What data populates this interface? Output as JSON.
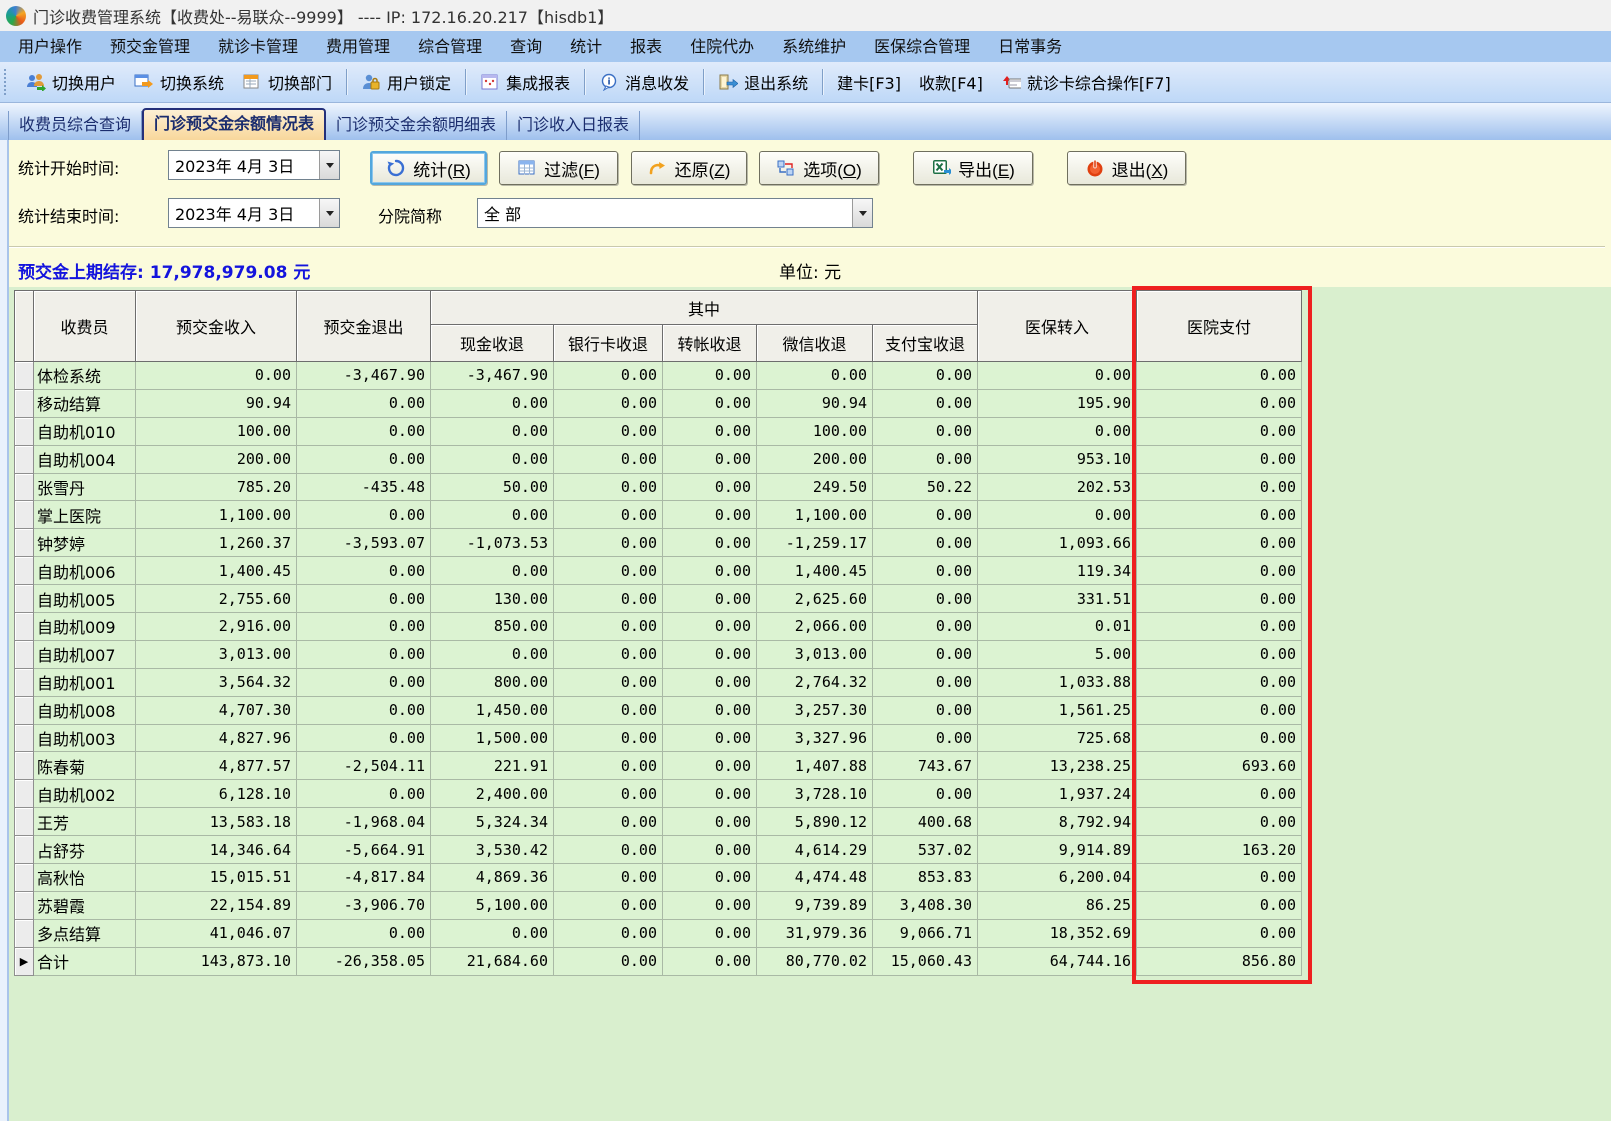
{
  "window": {
    "title": "门诊收费管理系统【收费处--易联众--9999】 ---- IP: 172.16.20.217【hisdb1】"
  },
  "menu": {
    "items": [
      "用户操作",
      "预交金管理",
      "就诊卡管理",
      "费用管理",
      "综合管理",
      "查询",
      "统计",
      "报表",
      "住院代办",
      "系统维护",
      "医保综合管理",
      "日常事务"
    ]
  },
  "toolbar": {
    "items": [
      {
        "type": "button",
        "label": "切换用户",
        "icon": "switch-user-icon"
      },
      {
        "type": "button",
        "label": "切换系统",
        "icon": "switch-system-icon"
      },
      {
        "type": "button",
        "label": "切换部门",
        "icon": "switch-department-icon"
      },
      {
        "type": "sep"
      },
      {
        "type": "button",
        "label": "用户锁定",
        "icon": "user-lock-icon"
      },
      {
        "type": "sep"
      },
      {
        "type": "button",
        "label": "集成报表",
        "icon": "integrated-report-icon"
      },
      {
        "type": "sep"
      },
      {
        "type": "button",
        "label": "消息收发",
        "icon": "message-icon"
      },
      {
        "type": "sep"
      },
      {
        "type": "button",
        "label": "退出系统",
        "icon": "exit-system-icon"
      },
      {
        "type": "sep"
      },
      {
        "type": "button",
        "label": "建卡[F3]",
        "icon": null
      },
      {
        "type": "button",
        "label": "收款[F4]",
        "icon": null
      },
      {
        "type": "button",
        "label": "就诊卡综合操作[F7]",
        "icon": "card-operations-icon"
      }
    ]
  },
  "tabs": [
    {
      "label": "收费员综合查询",
      "active": false
    },
    {
      "label": "门诊预交金余额情况表",
      "active": true
    },
    {
      "label": "门诊预交金余额明细表",
      "active": false
    },
    {
      "label": "门诊收入日报表",
      "active": false
    }
  ],
  "filters": {
    "start_label": "统计开始时间:",
    "start_value": "2023年  4月  3日",
    "end_label": "统计结束时间:",
    "end_value": "2023年  4月  3日",
    "branch_label": "分院简称",
    "branch_value": "全 部",
    "buttons": [
      {
        "label": "统计(R)",
        "icon": "refresh-icon",
        "default": true
      },
      {
        "label": "过滤(F)",
        "icon": "filter-icon",
        "default": false
      },
      {
        "label": "还原(Z)",
        "icon": "restore-icon",
        "default": false
      },
      {
        "label": "选项(O)",
        "icon": "options-icon",
        "default": false
      },
      {
        "label": "导出(E)",
        "icon": "export-excel-icon",
        "default": false
      },
      {
        "label": "退出(X)",
        "icon": "quit-icon",
        "default": false
      }
    ]
  },
  "summary": {
    "carryover_label": "预交金上期结存:",
    "carryover_value": "17,978,979.08",
    "carryover_unit": "元",
    "unit_note": "单位: 元"
  },
  "table": {
    "group_header": "其中",
    "columns": [
      "收费员",
      "预交金收入",
      "预交金退出",
      "现金收退",
      "银行卡收退",
      "转帐收退",
      "微信收退",
      "支付宝收退",
      "医保转入",
      "医院支付"
    ],
    "group_span_columns": [
      "现金收退",
      "银行卡收退",
      "转帐收退",
      "微信收退",
      "支付宝收退"
    ],
    "highlighted_column": "医院支付",
    "current_row_marker": "▶",
    "current_row_index": 21,
    "rows": [
      [
        "体检系统",
        "0.00",
        "-3,467.90",
        "-3,467.90",
        "0.00",
        "0.00",
        "0.00",
        "0.00",
        "0.00",
        "0.00"
      ],
      [
        "移动结算",
        "90.94",
        "0.00",
        "0.00",
        "0.00",
        "0.00",
        "90.94",
        "0.00",
        "195.90",
        "0.00"
      ],
      [
        "自助机010",
        "100.00",
        "0.00",
        "0.00",
        "0.00",
        "0.00",
        "100.00",
        "0.00",
        "0.00",
        "0.00"
      ],
      [
        "自助机004",
        "200.00",
        "0.00",
        "0.00",
        "0.00",
        "0.00",
        "200.00",
        "0.00",
        "953.10",
        "0.00"
      ],
      [
        "张雪丹",
        "785.20",
        "-435.48",
        "50.00",
        "0.00",
        "0.00",
        "249.50",
        "50.22",
        "202.53",
        "0.00"
      ],
      [
        "掌上医院",
        "1,100.00",
        "0.00",
        "0.00",
        "0.00",
        "0.00",
        "1,100.00",
        "0.00",
        "0.00",
        "0.00"
      ],
      [
        "钟梦婷",
        "1,260.37",
        "-3,593.07",
        "-1,073.53",
        "0.00",
        "0.00",
        "-1,259.17",
        "0.00",
        "1,093.66",
        "0.00"
      ],
      [
        "自助机006",
        "1,400.45",
        "0.00",
        "0.00",
        "0.00",
        "0.00",
        "1,400.45",
        "0.00",
        "119.34",
        "0.00"
      ],
      [
        "自助机005",
        "2,755.60",
        "0.00",
        "130.00",
        "0.00",
        "0.00",
        "2,625.60",
        "0.00",
        "331.51",
        "0.00"
      ],
      [
        "自助机009",
        "2,916.00",
        "0.00",
        "850.00",
        "0.00",
        "0.00",
        "2,066.00",
        "0.00",
        "0.01",
        "0.00"
      ],
      [
        "自助机007",
        "3,013.00",
        "0.00",
        "0.00",
        "0.00",
        "0.00",
        "3,013.00",
        "0.00",
        "5.00",
        "0.00"
      ],
      [
        "自助机001",
        "3,564.32",
        "0.00",
        "800.00",
        "0.00",
        "0.00",
        "2,764.32",
        "0.00",
        "1,033.88",
        "0.00"
      ],
      [
        "自助机008",
        "4,707.30",
        "0.00",
        "1,450.00",
        "0.00",
        "0.00",
        "3,257.30",
        "0.00",
        "1,561.25",
        "0.00"
      ],
      [
        "自助机003",
        "4,827.96",
        "0.00",
        "1,500.00",
        "0.00",
        "0.00",
        "3,327.96",
        "0.00",
        "725.68",
        "0.00"
      ],
      [
        "陈春菊",
        "4,877.57",
        "-2,504.11",
        "221.91",
        "0.00",
        "0.00",
        "1,407.88",
        "743.67",
        "13,238.25",
        "693.60"
      ],
      [
        "自助机002",
        "6,128.10",
        "0.00",
        "2,400.00",
        "0.00",
        "0.00",
        "3,728.10",
        "0.00",
        "1,937.24",
        "0.00"
      ],
      [
        "王芳",
        "13,583.18",
        "-1,968.04",
        "5,324.34",
        "0.00",
        "0.00",
        "5,890.12",
        "400.68",
        "8,792.94",
        "0.00"
      ],
      [
        "占舒芬",
        "14,346.64",
        "-5,664.91",
        "3,530.42",
        "0.00",
        "0.00",
        "4,614.29",
        "537.02",
        "9,914.89",
        "163.20"
      ],
      [
        "高秋怡",
        "15,015.51",
        "-4,817.84",
        "4,869.36",
        "0.00",
        "0.00",
        "4,474.48",
        "853.83",
        "6,200.04",
        "0.00"
      ],
      [
        "苏碧霞",
        "22,154.89",
        "-3,906.70",
        "5,100.00",
        "0.00",
        "0.00",
        "9,739.89",
        "3,408.30",
        "86.25",
        "0.00"
      ],
      [
        "多点结算",
        "41,046.07",
        "0.00",
        "0.00",
        "0.00",
        "0.00",
        "31,979.36",
        "9,066.71",
        "18,352.69",
        "0.00"
      ],
      [
        "合计",
        "143,873.10",
        "-26,358.05",
        "21,684.60",
        "0.00",
        "0.00",
        "80,770.02",
        "15,060.43",
        "64,744.16",
        "856.80"
      ]
    ]
  },
  "colors": {
    "highlight_border": "#ee2020",
    "summary_text": "#1414dd",
    "row_background": "#dcf3d2"
  }
}
